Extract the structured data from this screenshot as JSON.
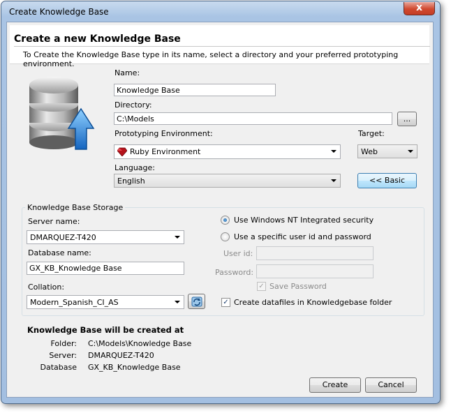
{
  "window": {
    "title": "Create Knowledge Base",
    "close_glyph": "x"
  },
  "header": {
    "title": "Create a new Knowledge Base",
    "description": "To Create the Knowledge Base type in its name, select a directory and your preferred prototyping environment."
  },
  "form": {
    "name_label": "Name:",
    "name_value": "Knowledge Base",
    "directory_label": "Directory:",
    "directory_value": "C:\\Models",
    "browse_label": "...",
    "proto_label": "Prototyping Environment:",
    "proto_value": "Ruby Environment",
    "target_label": "Target:",
    "target_value": "Web",
    "language_label": "Language:",
    "language_value": "English",
    "basic_button": "<< Basic"
  },
  "storage": {
    "group_title": "Knowledge Base Storage",
    "server_label": "Server name:",
    "server_value": "DMARQUEZ-T420",
    "database_label": "Database name:",
    "database_value": "GX_KB_Knowledge Base",
    "collation_label": "Collation:",
    "collation_value": "Modern_Spanish_CI_AS",
    "auth_nt": "Use Windows NT Integrated security",
    "auth_specific": "Use a specific user id and password",
    "userid_label": "User id:",
    "password_label": "Password:",
    "save_password": "Save Password",
    "create_datafiles": "Create datafiles in Knowledgebase folder",
    "auth_nt_selected": true,
    "save_password_checked": true,
    "create_datafiles_checked": true
  },
  "summary": {
    "title": "Knowledge Base will be created at",
    "folder_label": "Folder:",
    "folder_value": "C:\\Models\\Knowledge Base",
    "server_label": "Server:",
    "server_value": "DMARQUEZ-T420",
    "database_label": "Database",
    "database_value": "GX_KB_Knowledge Base"
  },
  "buttons": {
    "create": "Create",
    "cancel": "Cancel"
  },
  "icons": [
    "database-upload-icon",
    "ruby-icon",
    "refresh-icon",
    "close-icon"
  ]
}
